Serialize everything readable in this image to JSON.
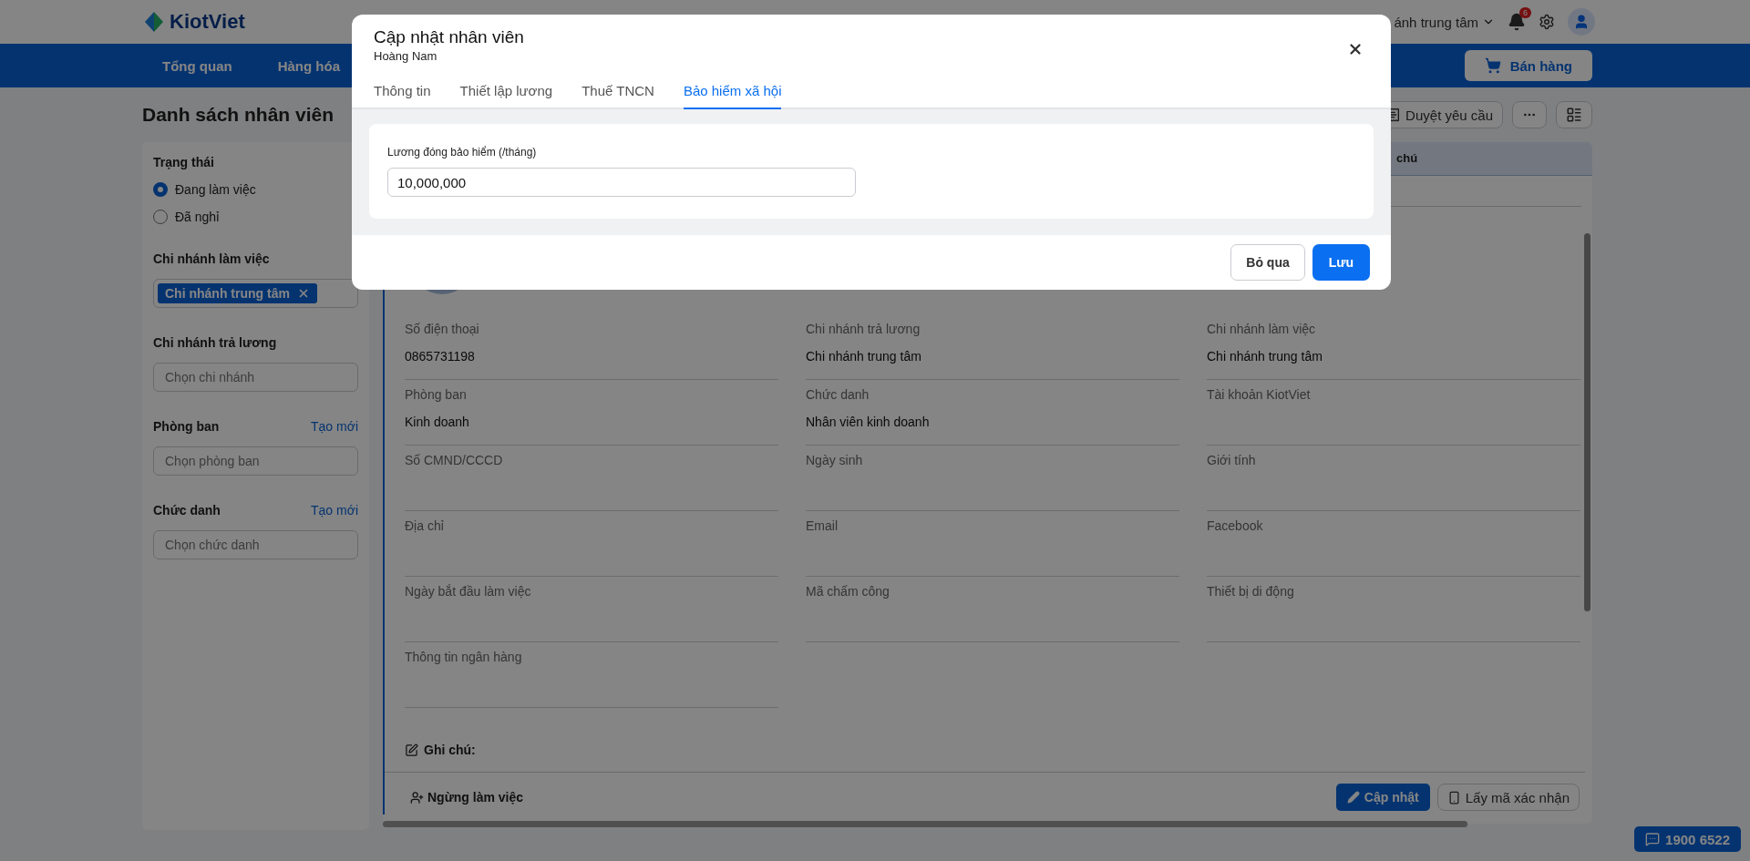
{
  "header": {
    "logo": "KiotViet",
    "branch": "ánh trung tâm",
    "notification_count": "6"
  },
  "nav": {
    "items": [
      {
        "label": "Tổng quan"
      },
      {
        "label": "Hàng hóa"
      }
    ],
    "sell_button": "Bán hàng"
  },
  "page": {
    "title": "Danh sách nhân viên",
    "review_button": "Duyệt yêu cầu"
  },
  "filters": [
    {
      "kind": "radio",
      "title": "Trạng thái",
      "options": [
        {
          "label": "Đang làm việc",
          "selected": true
        },
        {
          "label": "Đã nghỉ",
          "selected": false
        }
      ]
    },
    {
      "kind": "tags",
      "title": "Chi nhánh làm việc",
      "tags": [
        "Chi nhánh trung tâm"
      ]
    },
    {
      "kind": "select",
      "title": "Chi nhánh trả lương",
      "placeholder": "Chọn chi nhánh"
    },
    {
      "kind": "select",
      "title": "Phòng ban",
      "link": "Tạo mới",
      "placeholder": "Chọn phòng ban"
    },
    {
      "kind": "select",
      "title": "Chức danh",
      "link": "Tạo mới",
      "placeholder": "Chọn chức danh"
    }
  ],
  "table": {
    "column_header": "chú"
  },
  "detail": {
    "fields": [
      {
        "label": "Số điện thoại",
        "value": "0865731198"
      },
      {
        "label": "Chi nhánh trả lương",
        "value": "Chi nhánh trung tâm"
      },
      {
        "label": "Chi nhánh làm việc",
        "value": "Chi nhánh trung tâm"
      },
      {
        "label": "Phòng ban",
        "value": "Kinh doanh"
      },
      {
        "label": "Chức danh",
        "value": "Nhân viên kinh doanh"
      },
      {
        "label": "Tài khoản KiotViet"
      },
      {
        "label": "Số CMND/CCCD"
      },
      {
        "label": "Ngày sinh"
      },
      {
        "label": "Giới tính"
      },
      {
        "label": "Địa chỉ"
      },
      {
        "label": "Email"
      },
      {
        "label": "Facebook"
      },
      {
        "label": "Ngày bắt đầu làm việc"
      },
      {
        "label": "Mã chấm công"
      },
      {
        "label": "Thiết bị di động"
      },
      {
        "label": "Thông tin ngân hàng"
      }
    ],
    "note_label": "Ghi chú:",
    "stop_button": "Ngừng làm việc",
    "update_button": "Cập nhật",
    "code_button": "Lấy mã xác nhận"
  },
  "chat_button": "1900 6522",
  "modal": {
    "title": "Cập nhật nhân viên",
    "subtitle": "Hoàng Nam",
    "tabs": [
      {
        "label": "Thông tin",
        "selected": false
      },
      {
        "label": "Thiết lập lương",
        "selected": false
      },
      {
        "label": "Thuế TNCN",
        "selected": false
      },
      {
        "label": "Bảo hiểm xã hội",
        "selected": true
      }
    ],
    "field_label": "Lương đóng bảo hiểm (/tháng)",
    "field_value": "10,000,000",
    "cancel_button": "Bỏ qua",
    "save_button": "Lưu"
  }
}
